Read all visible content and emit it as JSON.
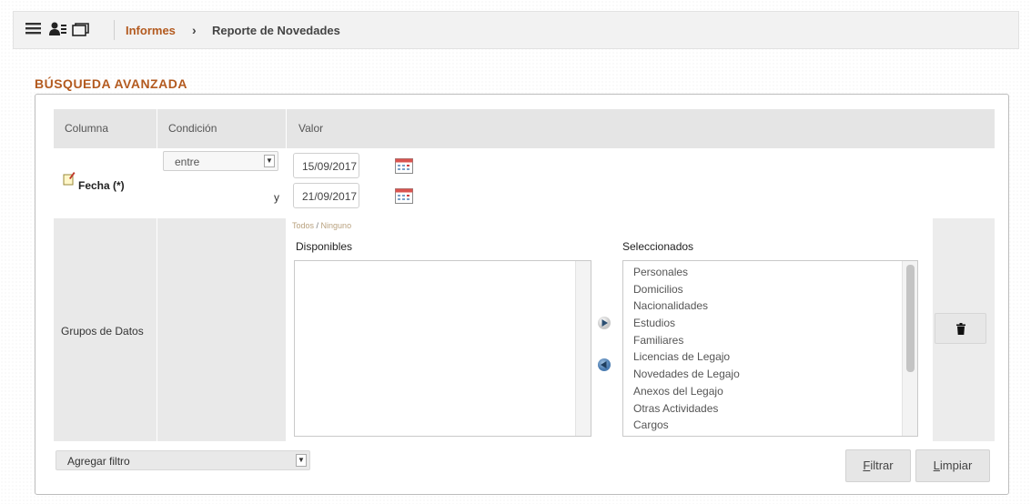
{
  "header": {
    "icons": [
      "menu-icon",
      "users-icon",
      "window-icon"
    ],
    "breadcrumb": {
      "parent": "Informes",
      "separator": "›",
      "current": "Reporte de Novedades"
    }
  },
  "section_title": "BÚSQUEDA AVANZADA",
  "table": {
    "columns": [
      "Columna",
      "Condición",
      "Valor"
    ],
    "fecha": {
      "label": "Fecha (*)",
      "condition": "entre",
      "join": "y",
      "date_from": "15/09/2017",
      "date_to": "21/09/2017"
    },
    "grupos": {
      "label": "Grupos de Datos",
      "todos": "Todos",
      "slash": " / ",
      "ninguno": "Ninguno",
      "available_label": "Disponibles",
      "selected_label": "Seleccionados",
      "available": [],
      "selected": [
        "Personales",
        "Domicilios",
        "Nacionalidades",
        "Estudios",
        "Familiares",
        "Licencias de Legajo",
        "Novedades de Legajo",
        "Anexos del Legajo",
        "Otras Actividades",
        "Cargos"
      ]
    }
  },
  "footer": {
    "add_filter": "Agregar filtro",
    "filtrar_first": "F",
    "filtrar_rest": "iltrar",
    "limpiar_first": "L",
    "limpiar_rest": "impiar"
  },
  "colors": {
    "accent": "#b35a1f",
    "header_bg": "#e5e5e5"
  }
}
